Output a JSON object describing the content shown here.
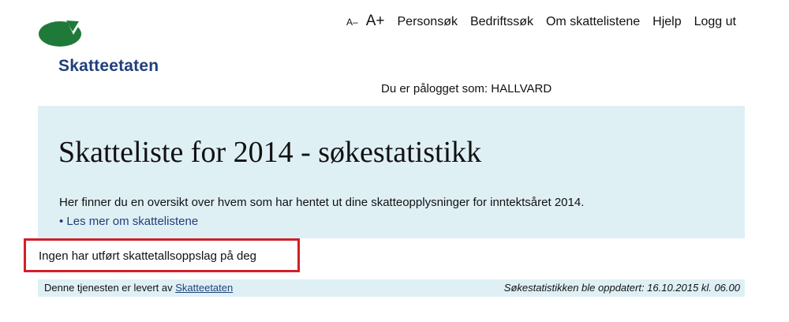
{
  "brand": {
    "name": "Skatteetaten",
    "color": "#1f3f7a",
    "logo_color": "#1f7a3a"
  },
  "topnav": {
    "font_decrease": "A–",
    "font_increase": "A+",
    "items": [
      "Personsøk",
      "Bedriftssøk",
      "Om skattelistene",
      "Hjelp",
      "Logg ut"
    ]
  },
  "login_status": "Du er pålogget som: HALLVARD",
  "hero": {
    "title": "Skatteliste for 2014 - søkestatistikk",
    "intro": "Her finner du en oversikt over hvem som har hentet ut dine skatteopplysninger for inntektsåret 2014.",
    "more_link": "Les mer om skattelistene",
    "background": "#dff0f5"
  },
  "result_message": "Ingen har utført skattetallsoppslag på deg",
  "highlight_color": "#d21f2a",
  "footer": {
    "provided_by": "Denne tjenesten er levert av",
    "provider_link": "Skatteetaten",
    "updated": "Søkestatistikken ble oppdatert: 16.10.2015 kl. 06.00"
  }
}
